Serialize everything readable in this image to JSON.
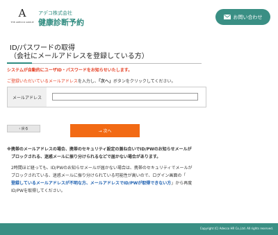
{
  "header": {
    "logo_mark": "A",
    "logo_sub": "THE ADECCO GROUP",
    "company": "アデコ株式会社",
    "service": "健康診断予約",
    "contact_label": "お問い合わせ"
  },
  "main": {
    "title_line1": "ID/パスワードの取得",
    "title_line2": "（会社にメールアドレスを登録している方）",
    "notice": "システムが自動的にユーザID・パスワードをお知らせいたします。",
    "instruction": {
      "red": "ご登録いただいているメールアドレス",
      "mid": "を入力し、",
      "strong": "「次へ」",
      "end": "ボタンをクリックしてください。"
    },
    "form": {
      "email_label": "メールアドレス",
      "email_value": ""
    },
    "back_label": "‹ 戻る",
    "next_label": "→ 次へ",
    "note1": {
      "line1": "※携帯のメールアドレスの場合、携帯のセキュリティ設定の兼ね合いでID/PWのお知らせメールが",
      "line2": "ブロックされる、迷惑メールに振り分けられるなどで届かない場合があります。"
    },
    "note2": {
      "line1": "2時間ほど経っても、ID/PWのお知らせメールが届かない場合は、携帯のセキュリティでメールが",
      "line2": "ブロックされている、迷惑メールに振り分けられている可能性が高いので、ログイン画面の「",
      "line3_link": "登録しているメールアドレスが不明な方、メールアドレスでID/PWが取得できない方",
      "line3_end": "」から再度",
      "line4": "ID/PWを取得してください。"
    }
  },
  "footer": {
    "copyright": "Copyright (C) Adecco HR Co.,Ltd. All rights reserved."
  },
  "colors": {
    "brand": "#3a8f84",
    "alert": "#e53b1f",
    "next_button": "#f26a14",
    "link": "#1a5eb0"
  }
}
